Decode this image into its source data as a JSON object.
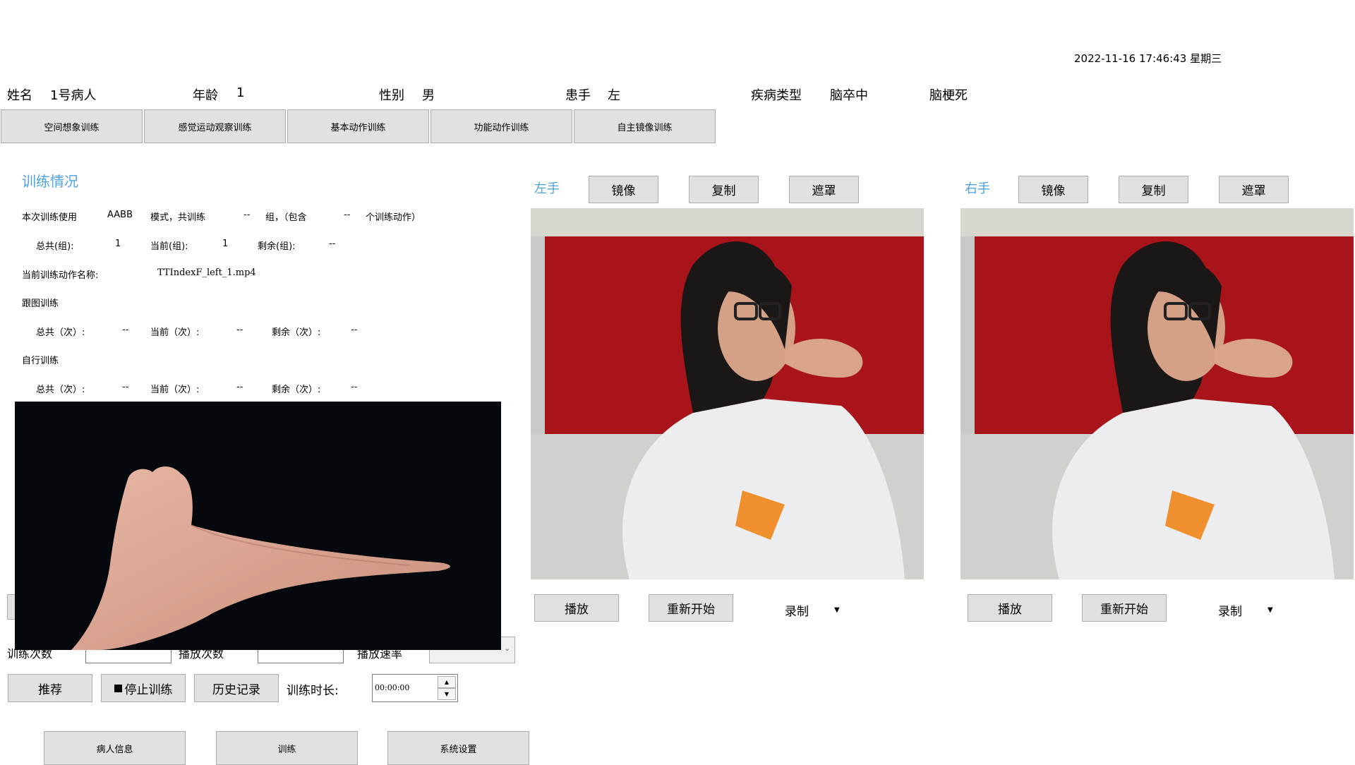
{
  "header": {
    "datetime": "2022-11-16 17:46:43 星期三"
  },
  "patient": {
    "name_label": "姓名",
    "name_value": "1号病人",
    "age_label": "年龄",
    "age_value": "1",
    "gender_label": "性别",
    "gender_value": "男",
    "hand_label": "患手",
    "hand_value": "左",
    "disease_label": "疾病类型",
    "disease_value": "脑卒中",
    "disease_subtype": "脑梗死"
  },
  "modes": [
    "空间想象训练",
    "感觉运动观察训练",
    "基本动作训练",
    "功能动作训练",
    "自主镜像训练"
  ],
  "status": {
    "title": "训练情况",
    "line1": {
      "a": "本次训练使用",
      "b": "AABB",
      "c": "模式，共训练",
      "d": "--",
      "e": "组，（包含",
      "f": "--",
      "g": "个训练动作）"
    },
    "groups": {
      "total_label": "总共(组):",
      "total": "1",
      "current_label": "当前(组):",
      "current": "1",
      "remaining_label": "剩余(组):",
      "remaining": "--"
    },
    "action_label": "当前训练动作名称:",
    "action_value": "TTIndexF_left_1.mp4",
    "follow_title": "跟图训练",
    "follow": {
      "total_label": "总共（次）:",
      "total": "--",
      "current_label": "当前（次）:",
      "current": "--",
      "remaining_label": "剩余（次）:",
      "remaining": "--"
    },
    "self_title": "自行训练",
    "self": {
      "total_label": "总共（次）:",
      "total": "--",
      "current_label": "当前（次）:",
      "current": "--",
      "remaining_label": "剩余（次）:",
      "remaining": "--"
    }
  },
  "controls": {
    "train_count_label": "训练次数",
    "play_count_label": "播放次数",
    "play_speed_label": "播放速率",
    "recommend": "推荐",
    "stop": "停止训练",
    "history": "历史记录",
    "duration_label": "训练时长:",
    "duration_value": "00:00:00"
  },
  "bottom_nav": [
    "病人信息",
    "训练",
    "系统设置"
  ],
  "left_panel": {
    "title": "左手",
    "mirror": "镜像",
    "copy": "复制",
    "mask": "遮罩",
    "play": "播放",
    "restart": "重新开始",
    "record": "录制"
  },
  "right_panel": {
    "title": "右手",
    "mirror": "镜像",
    "copy": "复制",
    "mask": "遮罩",
    "play": "播放",
    "restart": "重新开始",
    "record": "录制"
  }
}
